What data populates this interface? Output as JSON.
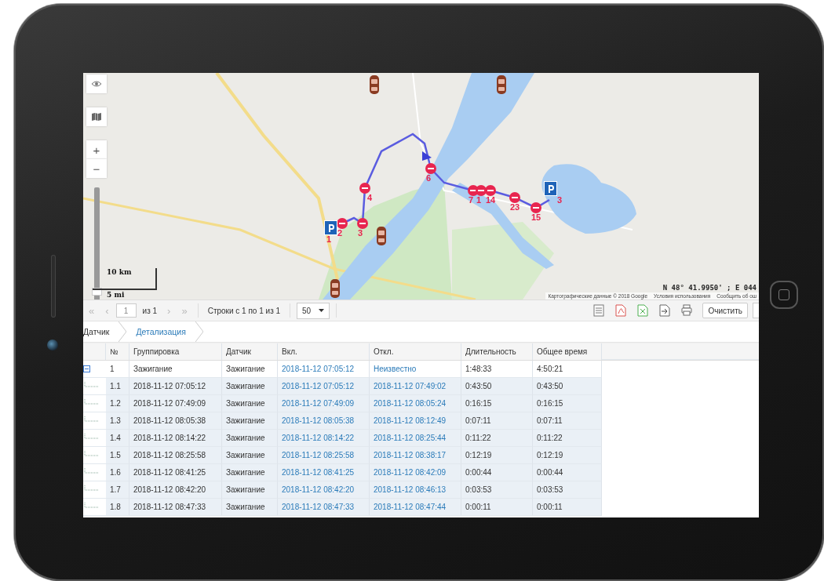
{
  "map": {
    "controls": {
      "zoom_in": "+",
      "zoom_out": "−"
    },
    "zoom_slider": {
      "level": 0.05
    },
    "stops": [
      {
        "label": "2"
      },
      {
        "label": "3"
      },
      {
        "label": "4"
      },
      {
        "label": "6"
      },
      {
        "label": "7"
      },
      {
        "label": "1"
      },
      {
        "label": "14"
      },
      {
        "label": "23"
      },
      {
        "label": "15"
      }
    ],
    "parkings": [
      {
        "label": "1"
      },
      {
        "label": "3"
      }
    ],
    "scale": {
      "metric": "10 km",
      "imperial": "5 mi"
    },
    "coordinates": "N 48° 41.9950' ; E 044",
    "attribution": [
      "Картографические данные © 2018 Google",
      "Условия использования",
      "Сообщить об ош"
    ]
  },
  "toolbar": {
    "pager": {
      "first": "«",
      "prev": "‹",
      "page": "1",
      "of": "из 1",
      "next": "›",
      "last": "»",
      "disabled": true
    },
    "rows_info": "Строки с 1 по 1 из 1",
    "page_size": "50",
    "tools": [
      {
        "kind": "columns"
      },
      {
        "kind": "pdf"
      },
      {
        "kind": "excel"
      },
      {
        "kind": "export"
      },
      {
        "kind": "print"
      }
    ],
    "clear_button": "Очистить"
  },
  "breadcrumbs": [
    {
      "label": "Датчик",
      "selected": false
    },
    {
      "label": "Детализация",
      "selected": true
    }
  ],
  "table": {
    "columns": [
      "№",
      "Группировка",
      "Датчик",
      "Вкл.",
      "Откл.",
      "Длительность",
      "Общее время"
    ],
    "rows": [
      {
        "kind": "group",
        "expanded": true,
        "cells": [
          "1",
          "Зажигание",
          "Зажигание",
          "2018-11-12 07:05:12",
          "Неизвестно",
          "1:48:33",
          "4:50:21"
        ]
      },
      {
        "kind": "entry",
        "cells": [
          "1.1",
          "2018-11-12 07:05:12",
          "Зажигание",
          "2018-11-12 07:05:12",
          "2018-11-12 07:49:02",
          "0:43:50",
          "0:43:50"
        ]
      },
      {
        "kind": "entry",
        "cells": [
          "1.2",
          "2018-11-12 07:49:09",
          "Зажигание",
          "2018-11-12 07:49:09",
          "2018-11-12 08:05:24",
          "0:16:15",
          "0:16:15"
        ]
      },
      {
        "kind": "entry",
        "cells": [
          "1.3",
          "2018-11-12 08:05:38",
          "Зажигание",
          "2018-11-12 08:05:38",
          "2018-11-12 08:12:49",
          "0:07:11",
          "0:07:11"
        ]
      },
      {
        "kind": "entry",
        "cells": [
          "1.4",
          "2018-11-12 08:14:22",
          "Зажигание",
          "2018-11-12 08:14:22",
          "2018-11-12 08:25:44",
          "0:11:22",
          "0:11:22"
        ]
      },
      {
        "kind": "entry",
        "cells": [
          "1.5",
          "2018-11-12 08:25:58",
          "Зажигание",
          "2018-11-12 08:25:58",
          "2018-11-12 08:38:17",
          "0:12:19",
          "0:12:19"
        ]
      },
      {
        "kind": "entry",
        "cells": [
          "1.6",
          "2018-11-12 08:41:25",
          "Зажигание",
          "2018-11-12 08:41:25",
          "2018-11-12 08:42:09",
          "0:00:44",
          "0:00:44"
        ]
      },
      {
        "kind": "entry",
        "cells": [
          "1.7",
          "2018-11-12 08:42:20",
          "Зажигание",
          "2018-11-12 08:42:20",
          "2018-11-12 08:46:13",
          "0:03:53",
          "0:03:53"
        ]
      },
      {
        "kind": "entry",
        "cells": [
          "1.8",
          "2018-11-12 08:47:33",
          "Зажигание",
          "2018-11-12 08:47:33",
          "2018-11-12 08:47:44",
          "0:00:11",
          "0:00:11"
        ]
      }
    ]
  }
}
